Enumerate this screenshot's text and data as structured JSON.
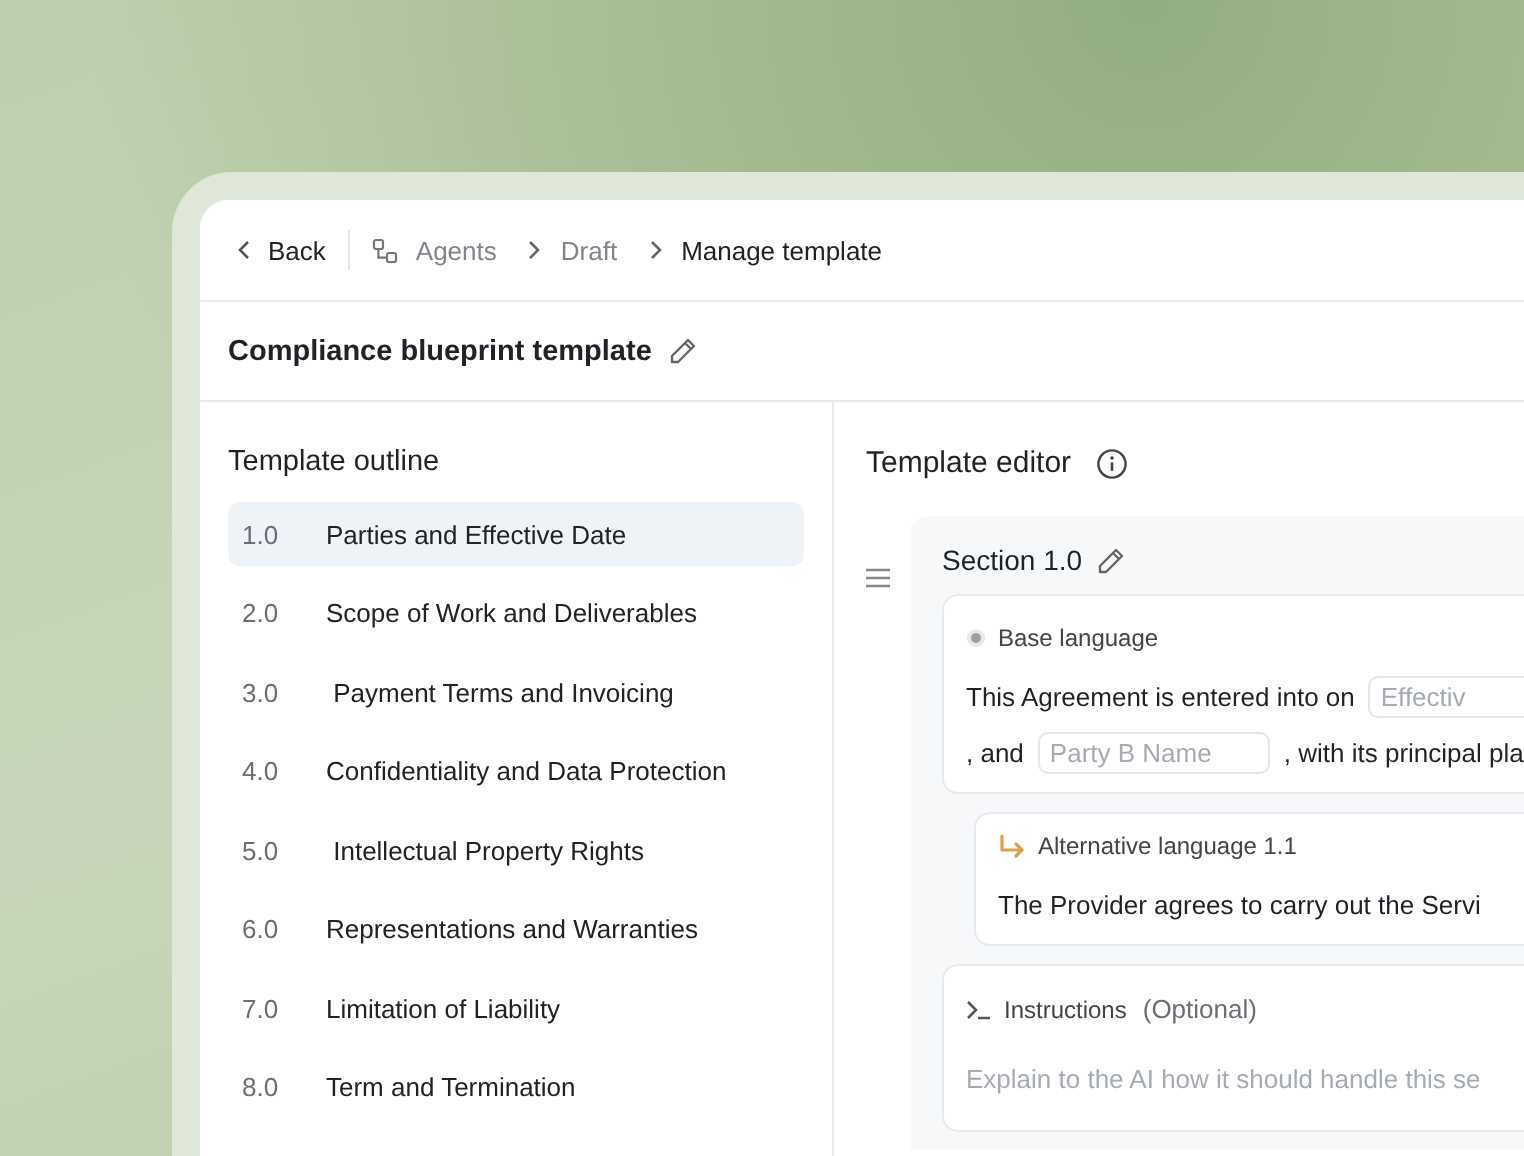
{
  "breadcrumb": {
    "back": "Back",
    "items": [
      {
        "label": "Agents",
        "current": false
      },
      {
        "label": "Draft",
        "current": false
      },
      {
        "label": "Manage template",
        "current": true
      }
    ]
  },
  "template_title": "Compliance blueprint template",
  "outline": {
    "title": "Template outline",
    "items": [
      {
        "number": "1.0",
        "label": "Parties and Effective Date",
        "selected": true
      },
      {
        "number": "2.0",
        "label": "Scope of Work and Deliverables",
        "selected": false
      },
      {
        "number": "3.0",
        "label": " Payment Terms and Invoicing",
        "selected": false
      },
      {
        "number": "4.0",
        "label": "Confidentiality and Data Protection",
        "selected": false
      },
      {
        "number": "5.0",
        "label": " Intellectual Property Rights",
        "selected": false
      },
      {
        "number": "6.0",
        "label": "Representations and Warranties",
        "selected": false
      },
      {
        "number": "7.0",
        "label": "Limitation of Liability",
        "selected": false
      },
      {
        "number": "8.0",
        "label": "Term and Termination",
        "selected": false
      }
    ]
  },
  "editor": {
    "title": "Template editor",
    "section": {
      "title": "Section 1.0",
      "base": {
        "label": "Base language",
        "lines": [
          [
            {
              "kind": "text",
              "text": "This Agreement is entered into on"
            },
            {
              "kind": "field",
              "placeholder": "Effectiv"
            }
          ],
          [
            {
              "kind": "text",
              "text": ", and"
            },
            {
              "kind": "field",
              "placeholder": "Party B Name"
            },
            {
              "kind": "text",
              "text": ", with its principal pla"
            }
          ]
        ]
      },
      "alternative": {
        "label": "Alternative language 1.1",
        "text": "The Provider agrees to carry out the Servi"
      },
      "instructions": {
        "label": "Instructions",
        "hint": "(Optional)",
        "placeholder": "Explain to the AI how it should handle this se"
      }
    }
  }
}
